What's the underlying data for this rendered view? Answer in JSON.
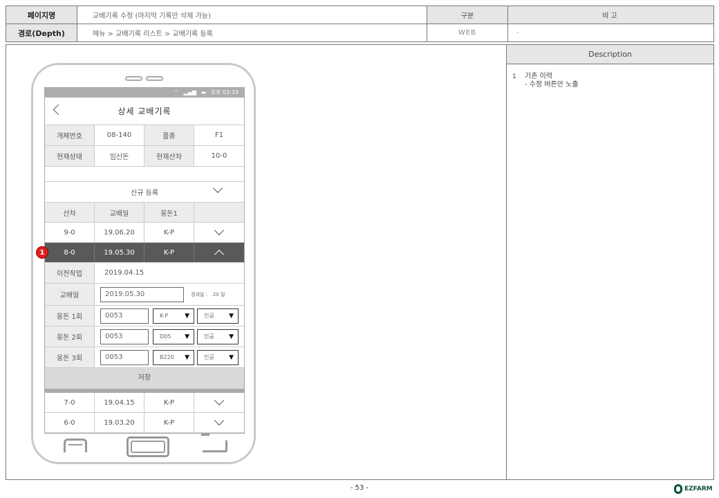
{
  "header": {
    "page_label": "페이지명",
    "page_value": "교배기록 수정 (마지막 기록만 삭제 가능)",
    "depth_label": "경로(Depth)",
    "depth_value": "메뉴 > 교배기록 리스트 > 교배기록 등록",
    "kind_label": "구분",
    "kind_value": "WEB",
    "note_label": "비고",
    "note_value": "-"
  },
  "description": {
    "title": "Description",
    "items": [
      {
        "num": "1",
        "line1": "기존 이력",
        "line2": "- 수정 버튼만 노출"
      }
    ]
  },
  "phone": {
    "status_text": "오후 03:33",
    "title": "상세 교배기록",
    "info": [
      [
        "개체번호",
        "08-140",
        "품종",
        "F1"
      ],
      [
        "현재상태",
        "임신돈",
        "현재산차",
        "10-0"
      ]
    ],
    "new_entry": "신규 등록",
    "list_headers": [
      "산차",
      "교배일",
      "웅돈1"
    ],
    "rows_top": [
      {
        "parity": "9-0",
        "date": "19.06.20",
        "boar": "K-P"
      }
    ],
    "selected": {
      "parity": "8-0",
      "date": "19.05.30",
      "boar": "K-P"
    },
    "detail": {
      "prev_label": "이전작업",
      "prev_value": "2019.04.15",
      "date_label": "교배일",
      "date_value": "2019.05.30",
      "elapsed_label": "경과일 :",
      "elapsed_value": "20 일",
      "boars": [
        {
          "label": "웅돈 1회",
          "code": "0053",
          "breed": "K-P",
          "method": "인공"
        },
        {
          "label": "웅돈 2회",
          "code": "0053",
          "breed": "D05",
          "method": "인공"
        },
        {
          "label": "웅돈 3회",
          "code": "0053",
          "breed": "B220",
          "method": "인공"
        }
      ],
      "save": "저장"
    },
    "rows_bottom": [
      {
        "parity": "7-0",
        "date": "19.04.15",
        "boar": "K-P"
      },
      {
        "parity": "6-0",
        "date": "19.03.20",
        "boar": "K-P"
      }
    ]
  },
  "badge": "1",
  "page_number": "- 53 -",
  "logo_text": "EZFARM"
}
